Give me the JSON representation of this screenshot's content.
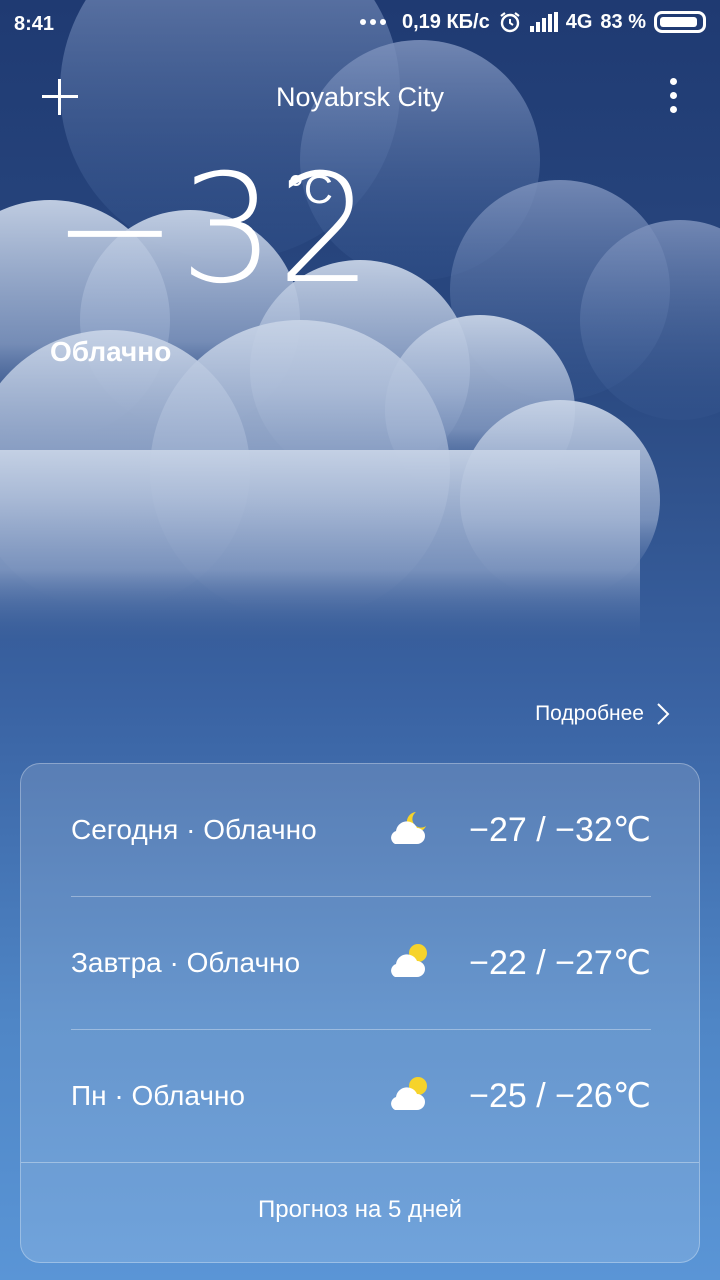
{
  "status": {
    "time": "8:41",
    "speed": "0,19 КБ/с",
    "network": "4G",
    "battery": "83 %",
    "icons": [
      "more-dots-icon",
      "alarm-icon",
      "signal-icon",
      "battery-icon"
    ]
  },
  "header": {
    "city": "Noyabrsk City",
    "add_icon": "plus-icon",
    "menu_icon": "more-vert-icon"
  },
  "current": {
    "temperature": "−32",
    "unit": "°C",
    "condition": "Облачно"
  },
  "details_link": "Подробнее",
  "forecast": [
    {
      "label": "Сегодня · Облачно",
      "temps": "−27  /  −32℃",
      "icon": "cloud-moon-icon"
    },
    {
      "label": "Завтра · Облачно",
      "temps": "−22  /  −27℃",
      "icon": "cloud-sun-icon"
    },
    {
      "label": "Пн · Облачно",
      "temps": "−25  /  −26℃",
      "icon": "cloud-sun-icon"
    }
  ],
  "forecast_button": "Прогноз на 5 дней",
  "colors": {
    "sun": "#f6d32b",
    "cloud": "#ffffff",
    "sky_top": "#1f3a72",
    "sky_bottom": "#5a95d6"
  }
}
